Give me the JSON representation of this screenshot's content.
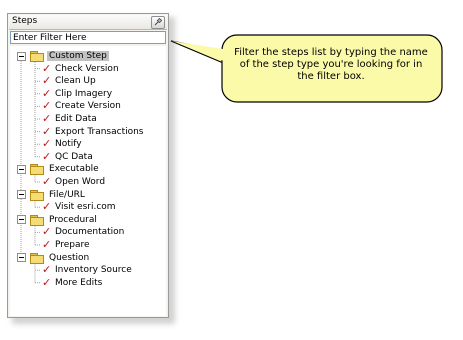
{
  "panel": {
    "title": "Steps",
    "filter_placeholder": "Enter Filter Here"
  },
  "tree": [
    {
      "label": "Custom Step",
      "selected": true,
      "items": [
        "Check Version",
        "Clean Up",
        "Clip Imagery",
        "Create Version",
        "Edit Data",
        "Export Transactions",
        "Notify",
        "QC Data"
      ]
    },
    {
      "label": "Executable",
      "items": [
        "Open Word"
      ]
    },
    {
      "label": "File/URL",
      "items": [
        "Visit esri.com"
      ]
    },
    {
      "label": "Procedural",
      "items": [
        "Documentation",
        "Prepare"
      ]
    },
    {
      "label": "Question",
      "items": [
        "Inventory Source",
        "More Edits"
      ]
    }
  ],
  "callout": {
    "text": "Filter the steps list by typing the name of the step type you're looking for in the filter box."
  },
  "colors": {
    "callout_fill": "#fbfaa8",
    "callout_border": "#000000",
    "check_mark": "#c01414",
    "folder": "#f6dc74"
  }
}
